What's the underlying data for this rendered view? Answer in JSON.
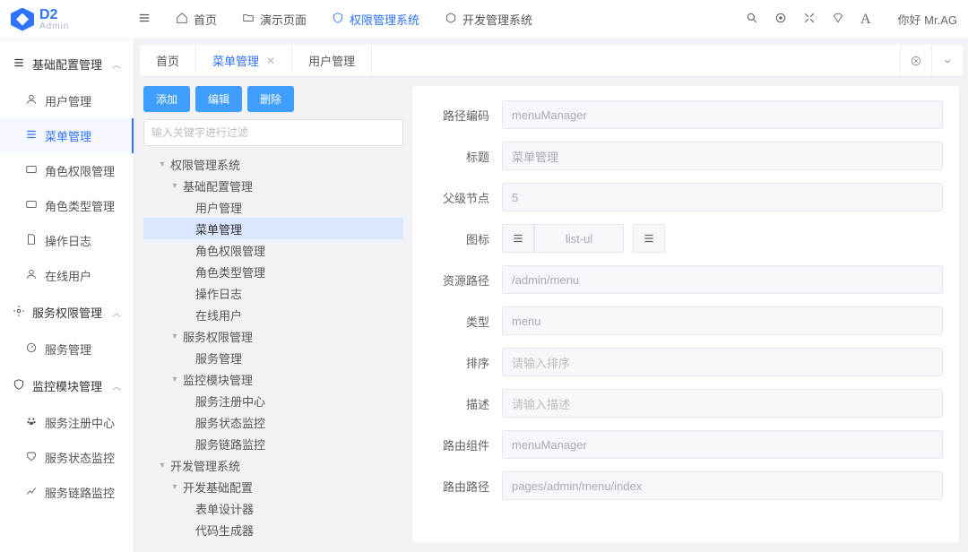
{
  "brand": {
    "d2": "D2",
    "admin": "Admin"
  },
  "topnav": [
    {
      "label": "首页",
      "icon": "home",
      "active": false
    },
    {
      "label": "演示页面",
      "icon": "folder",
      "active": false
    },
    {
      "label": "权限管理系统",
      "icon": "shield",
      "active": true
    },
    {
      "label": "开发管理系统",
      "icon": "hex",
      "active": false
    }
  ],
  "hello": "你好 Mr.AG",
  "sidebar": [
    {
      "type": "group",
      "label": "基础配置管理",
      "icon": "list",
      "expanded": true
    },
    {
      "type": "item",
      "label": "用户管理",
      "icon": "user"
    },
    {
      "type": "item",
      "label": "菜单管理",
      "icon": "list",
      "active": true
    },
    {
      "type": "item",
      "label": "角色权限管理",
      "icon": "id"
    },
    {
      "type": "item",
      "label": "角色类型管理",
      "icon": "id"
    },
    {
      "type": "item",
      "label": "操作日志",
      "icon": "file"
    },
    {
      "type": "item",
      "label": "在线用户",
      "icon": "user"
    },
    {
      "type": "group",
      "label": "服务权限管理",
      "icon": "gears",
      "expanded": true
    },
    {
      "type": "item",
      "label": "服务管理",
      "icon": "dash"
    },
    {
      "type": "group",
      "label": "监控模块管理",
      "icon": "shield",
      "expanded": true
    },
    {
      "type": "item",
      "label": "服务注册中心",
      "icon": "paw"
    },
    {
      "type": "item",
      "label": "服务状态监控",
      "icon": "heart"
    },
    {
      "type": "item",
      "label": "服务链路监控",
      "icon": "chart"
    }
  ],
  "tabs": [
    {
      "label": "首页",
      "closable": false,
      "active": false
    },
    {
      "label": "菜单管理",
      "closable": true,
      "active": true
    },
    {
      "label": "用户管理",
      "closable": false,
      "active": false
    }
  ],
  "toolbar": {
    "add": "添加",
    "edit": "编辑",
    "del": "删除"
  },
  "filter_placeholder": "输入关键字进行过滤",
  "tree": [
    {
      "d": 1,
      "caret": "▾",
      "label": "权限管理系统"
    },
    {
      "d": 2,
      "caret": "▾",
      "label": "基础配置管理"
    },
    {
      "d": 3,
      "caret": "",
      "label": "用户管理"
    },
    {
      "d": 3,
      "caret": "",
      "label": "菜单管理",
      "sel": true
    },
    {
      "d": 3,
      "caret": "",
      "label": "角色权限管理"
    },
    {
      "d": 3,
      "caret": "",
      "label": "角色类型管理"
    },
    {
      "d": 3,
      "caret": "",
      "label": "操作日志"
    },
    {
      "d": 3,
      "caret": "",
      "label": "在线用户"
    },
    {
      "d": 2,
      "caret": "▾",
      "label": "服务权限管理"
    },
    {
      "d": 3,
      "caret": "",
      "label": "服务管理"
    },
    {
      "d": 2,
      "caret": "▾",
      "label": "监控模块管理"
    },
    {
      "d": 3,
      "caret": "",
      "label": "服务注册中心"
    },
    {
      "d": 3,
      "caret": "",
      "label": "服务状态监控"
    },
    {
      "d": 3,
      "caret": "",
      "label": "服务链路监控"
    },
    {
      "d": 1,
      "caret": "▾",
      "label": "开发管理系统"
    },
    {
      "d": 2,
      "caret": "▾",
      "label": "开发基础配置"
    },
    {
      "d": 3,
      "caret": "",
      "label": "表单设计器"
    },
    {
      "d": 3,
      "caret": "",
      "label": "代码生成器"
    }
  ],
  "form": {
    "pathCode": {
      "label": "路径编码",
      "value": "menuManager"
    },
    "title": {
      "label": "标题",
      "value": "菜单管理"
    },
    "parent": {
      "label": "父级节点",
      "value": "5"
    },
    "icon": {
      "label": "图标",
      "value": "list-ul"
    },
    "resPath": {
      "label": "资源路径",
      "value": "/admin/menu"
    },
    "type": {
      "label": "类型",
      "value": "menu"
    },
    "order": {
      "label": "排序",
      "placeholder": "请输入排序"
    },
    "desc": {
      "label": "描述",
      "placeholder": "请输入描述"
    },
    "routeComp": {
      "label": "路由组件",
      "value": "menuManager"
    },
    "routePath": {
      "label": "路由路径",
      "value": "pages/admin/menu/index"
    }
  }
}
